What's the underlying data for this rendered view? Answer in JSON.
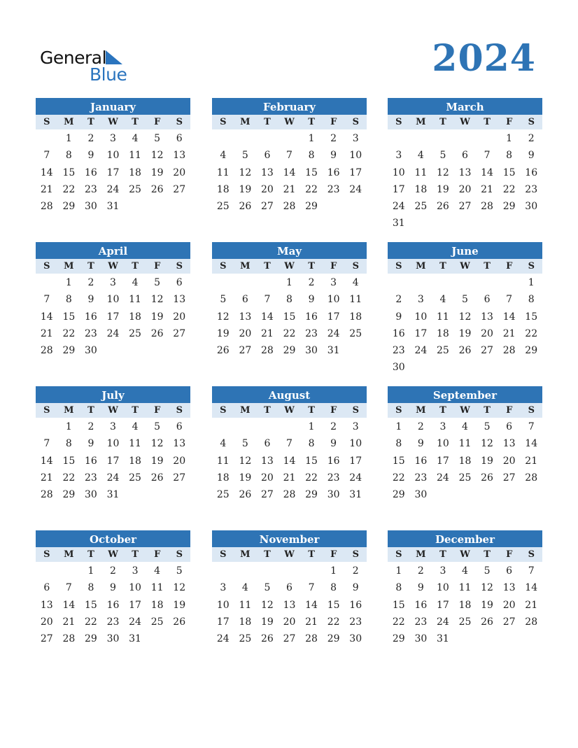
{
  "brand": {
    "name_top": "General",
    "name_bottom": "Blue",
    "color": "#2a74be"
  },
  "year": "2024",
  "colors": {
    "header_bg": "#2e74b5",
    "dow_bg": "#dce8f4"
  },
  "weekdays": [
    "S",
    "M",
    "T",
    "W",
    "T",
    "F",
    "S"
  ],
  "months": [
    {
      "name": "January",
      "start": 1,
      "days": 31
    },
    {
      "name": "February",
      "start": 4,
      "days": 29
    },
    {
      "name": "March",
      "start": 5,
      "days": 31
    },
    {
      "name": "April",
      "start": 1,
      "days": 30
    },
    {
      "name": "May",
      "start": 3,
      "days": 31
    },
    {
      "name": "June",
      "start": 6,
      "days": 30
    },
    {
      "name": "July",
      "start": 1,
      "days": 31
    },
    {
      "name": "August",
      "start": 4,
      "days": 31
    },
    {
      "name": "September",
      "start": 0,
      "days": 30
    },
    {
      "name": "October",
      "start": 2,
      "days": 31
    },
    {
      "name": "November",
      "start": 5,
      "days": 30
    },
    {
      "name": "December",
      "start": 0,
      "days": 31
    }
  ]
}
